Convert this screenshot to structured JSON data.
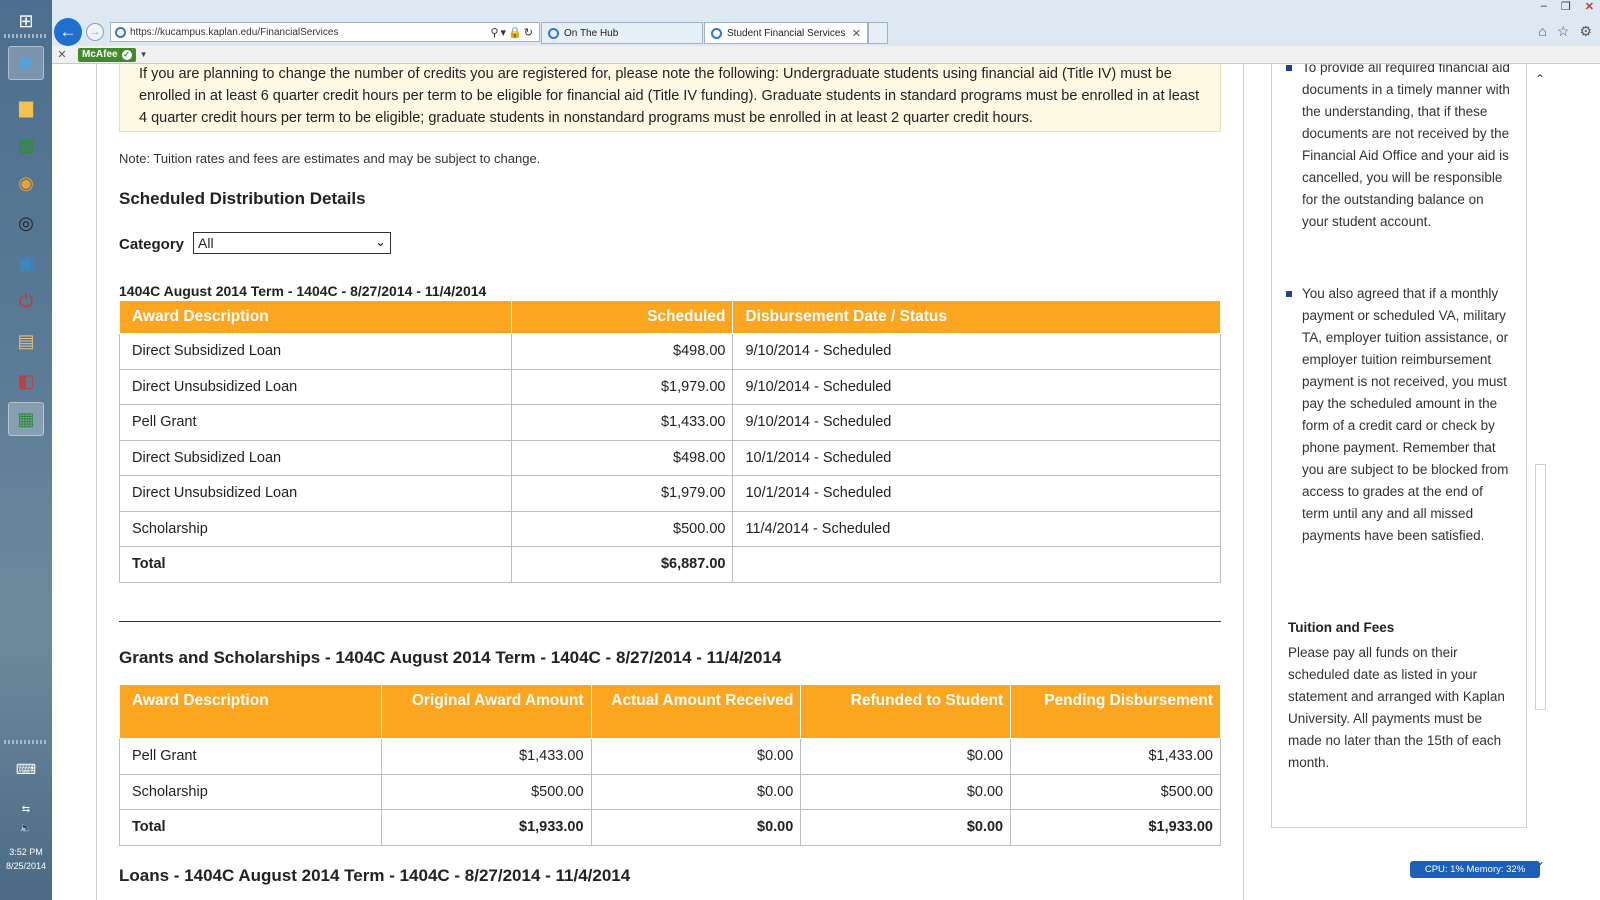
{
  "browser": {
    "url": "https://kucampus.kaplan.edu/FinancialServices",
    "tabs": [
      {
        "label": "On The Hub"
      },
      {
        "label": "Student Financial Services"
      }
    ],
    "toolbar_addon": "McAfee"
  },
  "taskbar": {
    "time": "3:52 PM",
    "date": "8/25/2014"
  },
  "status_widget": "CPU: 1%   Memory: 32%",
  "page": {
    "notice_text": "If you are planning to change the number of credits you are registered for, please note the following: Undergraduate students using financial aid (Title IV) must be enrolled in at least 6 quarter credit hours per term to be eligible for financial aid (Title IV funding). Graduate students in standard programs must be enrolled in at least 4 quarter credit hours per term to be eligible; graduate students in nonstandard programs must be enrolled in at least 2 quarter credit hours.",
    "note": "Note: Tuition rates and fees are estimates and may be subject to change.",
    "distribution_heading": "Scheduled Distribution Details",
    "category_label": "Category",
    "category_value": "All",
    "term_heading": "1404C August 2014 Term - 1404C - 8/27/2014 - 11/4/2014",
    "distribution_table": {
      "headers": [
        "Award Description",
        "Scheduled",
        "Disbursement Date / Status"
      ],
      "rows": [
        [
          "Direct Subsidized Loan",
          "$498.00",
          "9/10/2014 - Scheduled"
        ],
        [
          "Direct Unsubsidized Loan",
          "$1,979.00",
          "9/10/2014 - Scheduled"
        ],
        [
          "Pell Grant",
          "$1,433.00",
          "9/10/2014 - Scheduled"
        ],
        [
          "Direct Subsidized Loan",
          "$498.00",
          "10/1/2014 - Scheduled"
        ],
        [
          "Direct Unsubsidized Loan",
          "$1,979.00",
          "10/1/2014 - Scheduled"
        ],
        [
          "Scholarship",
          "$500.00",
          "11/4/2014 - Scheduled"
        ]
      ],
      "total": [
        "Total",
        "$6,887.00",
        ""
      ]
    },
    "grants_heading": "Grants and Scholarships - 1404C August 2014 Term - 1404C - 8/27/2014 - 11/4/2014",
    "grants_table": {
      "headers": [
        "Award Description",
        "Original Award Amount",
        "Actual Amount Received",
        "Refunded to Student",
        "Pending Disbursement"
      ],
      "rows": [
        [
          "Pell Grant",
          "$1,433.00",
          "$0.00",
          "$0.00",
          "$1,433.00"
        ],
        [
          "Scholarship",
          "$500.00",
          "$0.00",
          "$0.00",
          "$500.00"
        ]
      ],
      "total": [
        "Total",
        "$1,933.00",
        "$0.00",
        "$0.00",
        "$1,933.00"
      ]
    },
    "loans_heading": "Loans - 1404C August 2014 Term - 1404C - 8/27/2014 - 11/4/2014"
  },
  "sidebar": {
    "bullet_1": "To provide all required financial aid documents in a timely manner with the understanding, that if these documents are not received by the Financial Aid Office and your aid is cancelled, you will be responsible for the outstanding balance on your student account.",
    "bullet_2": "You also agreed that if a monthly payment or scheduled VA, military TA, employer tuition assistance, or employer tuition reimbursement payment is not received, you must pay the scheduled amount in the form of a credit card or check by phone payment. Remember that you are subject to be blocked from access to grades at the end of term until any and all missed payments have been satisfied.",
    "tuition_heading": "Tuition and Fees",
    "tuition_body": "Please pay all funds on their scheduled date as listed in your statement and arranged with Kaplan University. All payments must be made no later than the 15th of each month."
  },
  "colors": {
    "table_header": "#fca61f",
    "notice_bg": "#fdf9e3",
    "accent_blue": "#1f6fd0"
  }
}
